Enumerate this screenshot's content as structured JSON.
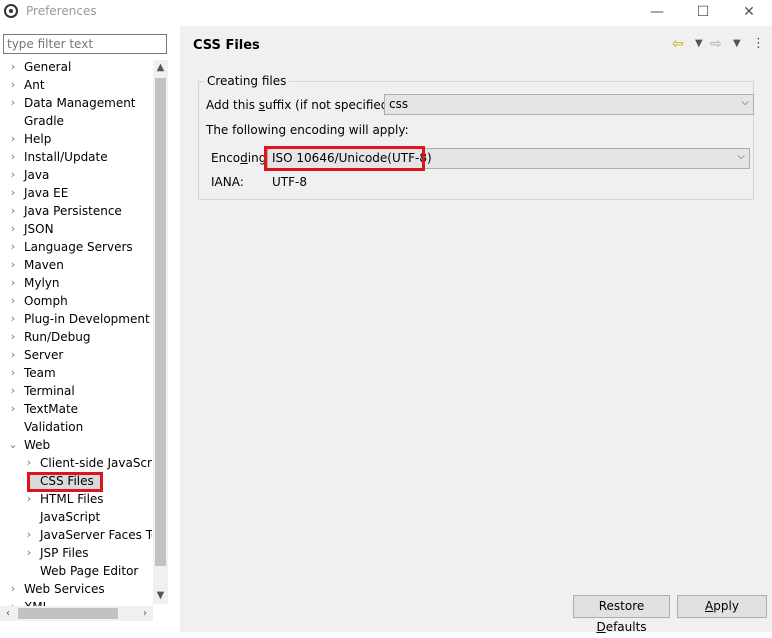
{
  "window": {
    "title": "Preferences",
    "minimize_glyph": "—",
    "maximize_glyph": "☐",
    "close_glyph": "✕"
  },
  "sidebar": {
    "filter_placeholder": "type filter text",
    "items": [
      {
        "label": "General",
        "expandable": true,
        "level": 0
      },
      {
        "label": "Ant",
        "expandable": true,
        "level": 0
      },
      {
        "label": "Data Management",
        "expandable": true,
        "level": 0
      },
      {
        "label": "Gradle",
        "expandable": false,
        "level": 0
      },
      {
        "label": "Help",
        "expandable": true,
        "level": 0
      },
      {
        "label": "Install/Update",
        "expandable": true,
        "level": 0
      },
      {
        "label": "Java",
        "expandable": true,
        "level": 0
      },
      {
        "label": "Java EE",
        "expandable": true,
        "level": 0
      },
      {
        "label": "Java Persistence",
        "expandable": true,
        "level": 0
      },
      {
        "label": "JSON",
        "expandable": true,
        "level": 0
      },
      {
        "label": "Language Servers",
        "expandable": true,
        "level": 0
      },
      {
        "label": "Maven",
        "expandable": true,
        "level": 0
      },
      {
        "label": "Mylyn",
        "expandable": true,
        "level": 0
      },
      {
        "label": "Oomph",
        "expandable": true,
        "level": 0
      },
      {
        "label": "Plug-in Development",
        "expandable": true,
        "level": 0
      },
      {
        "label": "Run/Debug",
        "expandable": true,
        "level": 0
      },
      {
        "label": "Server",
        "expandable": true,
        "level": 0
      },
      {
        "label": "Team",
        "expandable": true,
        "level": 0
      },
      {
        "label": "Terminal",
        "expandable": true,
        "level": 0
      },
      {
        "label": "TextMate",
        "expandable": true,
        "level": 0
      },
      {
        "label": "Validation",
        "expandable": false,
        "level": 0
      },
      {
        "label": "Web",
        "expandable": true,
        "expanded": true,
        "level": 0
      },
      {
        "label": "Client-side JavaScript",
        "expandable": true,
        "level": 1
      },
      {
        "label": "CSS Files",
        "expandable": true,
        "level": 1,
        "selected": true
      },
      {
        "label": "HTML Files",
        "expandable": true,
        "level": 1
      },
      {
        "label": "JavaScript",
        "expandable": false,
        "level": 1
      },
      {
        "label": "JavaServer Faces Tools",
        "expandable": true,
        "level": 1
      },
      {
        "label": "JSP Files",
        "expandable": true,
        "level": 1
      },
      {
        "label": "Web Page Editor",
        "expandable": false,
        "level": 1
      },
      {
        "label": "Web Services",
        "expandable": true,
        "level": 0
      },
      {
        "label": "XML",
        "expandable": true,
        "level": 0
      }
    ]
  },
  "page": {
    "title": "CSS Files",
    "group_title": "Creating files",
    "suffix_label_pre": "Add this ",
    "suffix_label_mnemonic": "s",
    "suffix_label_post": "uffix (if not specified):",
    "suffix_value": "css",
    "encoding_note": "The following encoding will apply:",
    "encoding_label_pre": "Enco",
    "encoding_label_mnemonic": "d",
    "encoding_label_post": "ing:",
    "encoding_value": "ISO 10646/Unicode(UTF-8)",
    "iana_label": "IANA:",
    "iana_value": "UTF-8"
  },
  "buttons": {
    "restore_pre": "Restore ",
    "restore_mnemonic": "D",
    "restore_post": "efaults",
    "apply_pre": "",
    "apply_mnemonic": "A",
    "apply_post": "pply"
  },
  "icons": {
    "back": "back-arrow-icon",
    "forward": "forward-arrow-icon",
    "menu": "view-menu-icon"
  },
  "colors": {
    "highlight": "#e0151b",
    "right_bg": "#f0f0f0",
    "nav_arrow": "#c8a200"
  }
}
